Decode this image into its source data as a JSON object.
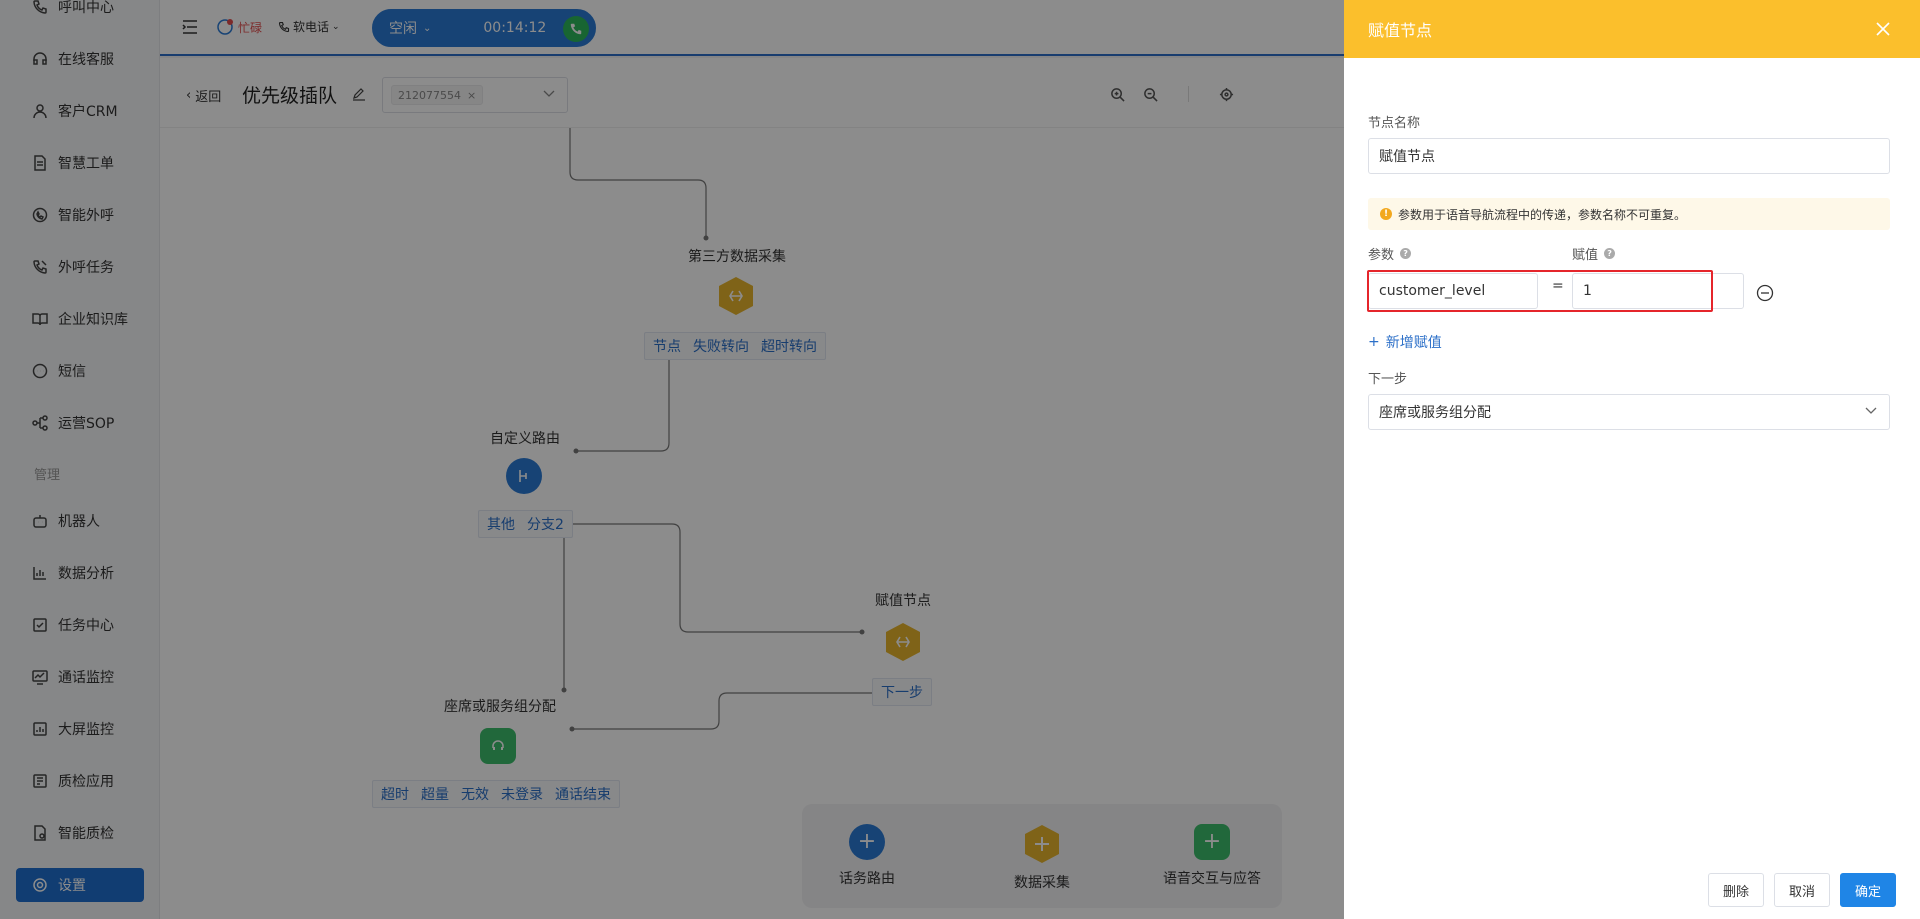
{
  "sidebar": {
    "items": [
      {
        "label": "呼叫中心",
        "icon": "phone-icon"
      },
      {
        "label": "在线客服",
        "icon": "headset-icon"
      },
      {
        "label": "客户CRM",
        "icon": "user-icon"
      },
      {
        "label": "智慧工单",
        "icon": "ticket-icon"
      },
      {
        "label": "智能外呼",
        "icon": "whatsapp-phone-icon"
      },
      {
        "label": "外呼任务",
        "icon": "phone-task-icon"
      },
      {
        "label": "企业知识库",
        "icon": "book-icon"
      },
      {
        "label": "短信",
        "icon": "sms-icon"
      },
      {
        "label": "运营SOP",
        "icon": "flow-icon"
      }
    ],
    "section_manage": "管理",
    "manage_items": [
      {
        "label": "机器人",
        "icon": "robot-icon"
      },
      {
        "label": "数据分析",
        "icon": "chart-icon"
      },
      {
        "label": "任务中心",
        "icon": "task-icon"
      },
      {
        "label": "通话监控",
        "icon": "monitor-icon"
      },
      {
        "label": "大屏监控",
        "icon": "screen-icon"
      },
      {
        "label": "质检应用",
        "icon": "qc-icon"
      },
      {
        "label": "智能质检",
        "icon": "smart-qc-icon"
      },
      {
        "label": "设置",
        "icon": "gear-icon"
      }
    ]
  },
  "topbar": {
    "brand": "忙碌",
    "phone": "软电话",
    "status": "空闲",
    "timer": "00:14:12"
  },
  "subheader": {
    "back": "返回",
    "title": "优先级插队",
    "tag": "212077554"
  },
  "canvas": {
    "node_third_party": "第三方数据采集",
    "ports_third_party": [
      "节点",
      "失败转向",
      "超时转向"
    ],
    "node_custom_route": "自定义路由",
    "ports_custom_route": [
      "其他",
      "分支2"
    ],
    "node_assign": "赋值节点",
    "ports_assign": [
      "下一步"
    ],
    "node_seat": "座席或服务组分配",
    "ports_seat": [
      "超时",
      "超量",
      "无效",
      "未登录",
      "通话结束"
    ],
    "palette": [
      "话务路由",
      "数据采集",
      "语音交互与应答"
    ]
  },
  "drawer": {
    "title": "赋值节点",
    "name_label": "节点名称",
    "name_value": "赋值节点",
    "notice": "参数用于语音导航流程中的传递，参数名称不可重复。",
    "param_label": "参数",
    "value_label": "赋值",
    "param_value": "customer_level",
    "eq": "=",
    "assign_value": "1",
    "add_link": "新增赋值",
    "next_label": "下一步",
    "next_value": "座席或服务组分配",
    "btn_delete": "删除",
    "btn_cancel": "取消",
    "btn_ok": "确定"
  },
  "colors": {
    "drawer_header": "#fbbf2c",
    "primary": "#1f85e6",
    "highlight_border": "#e5252b",
    "sidebar_active": "#1f6fd0",
    "hex_node": "#e8b52c",
    "square_node": "#3cbd6c"
  }
}
